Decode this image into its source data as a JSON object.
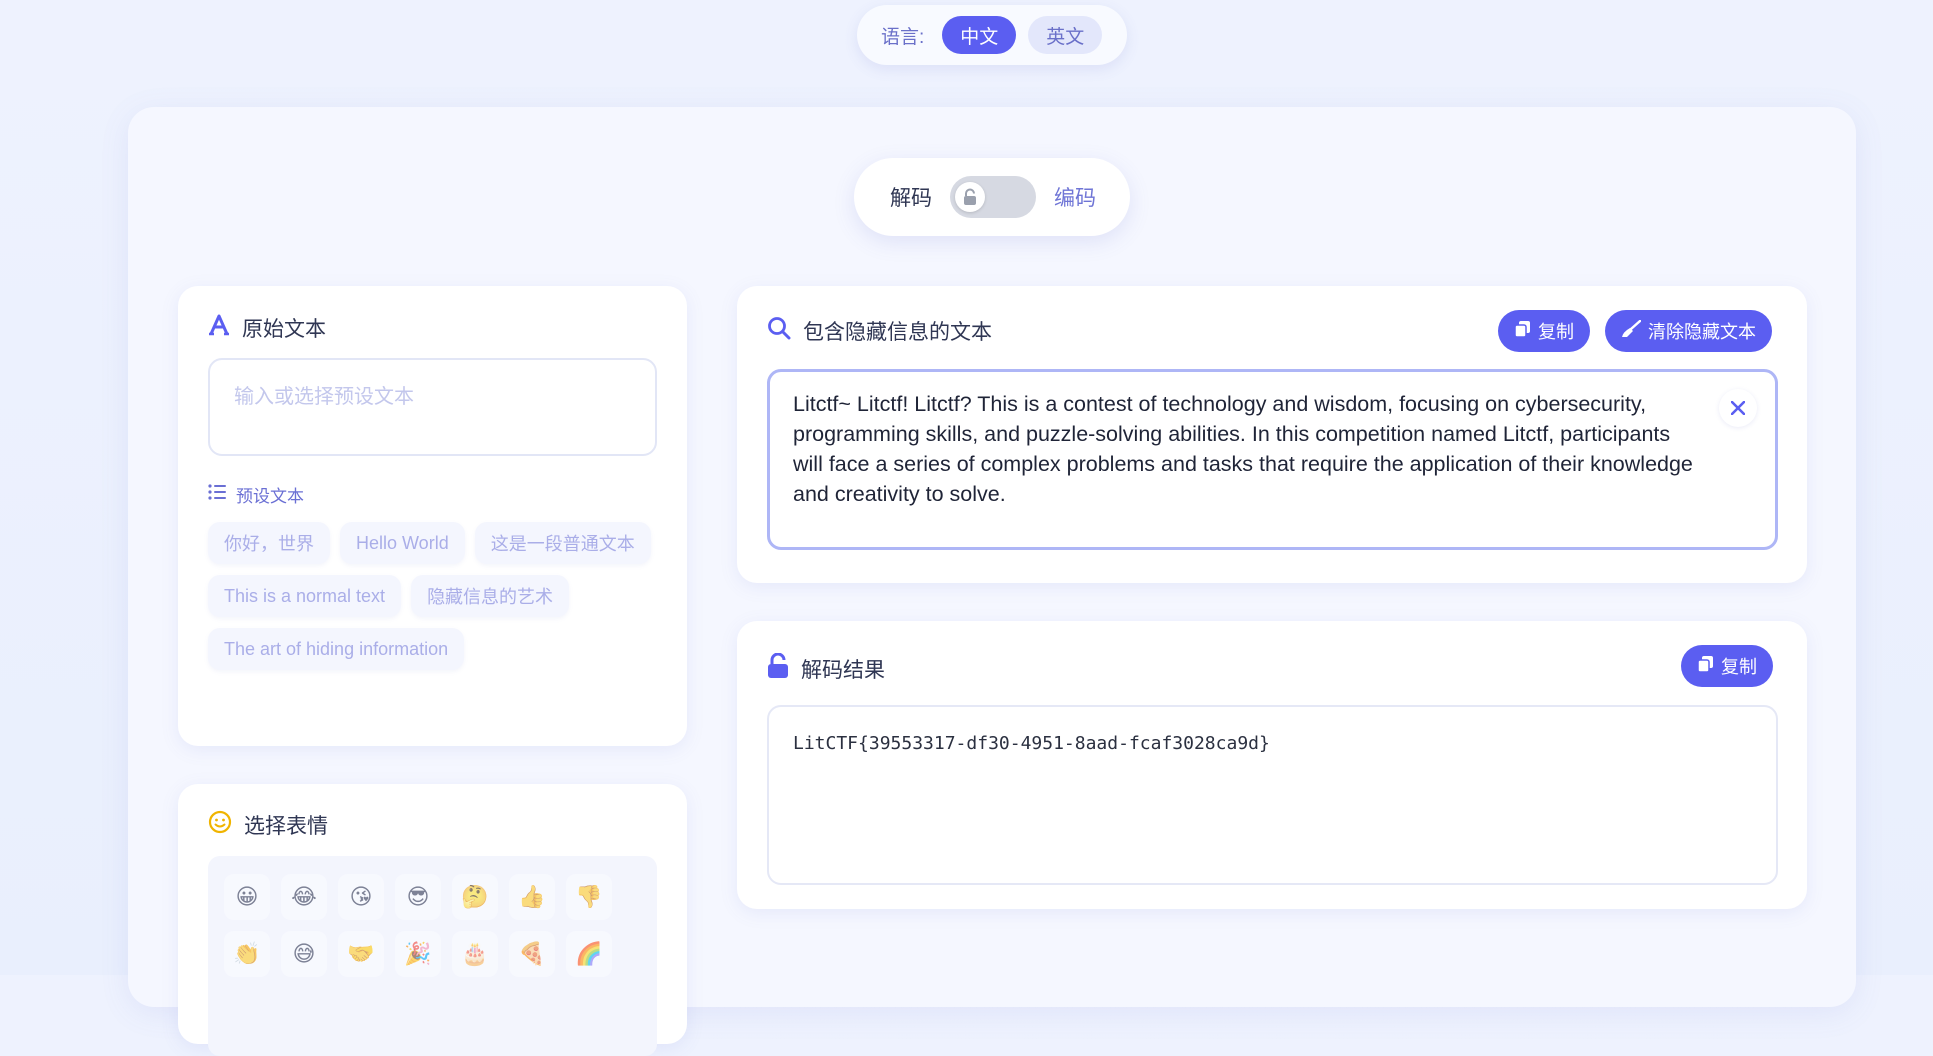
{
  "language": {
    "label": "语言:",
    "options": [
      "中文",
      "英文"
    ],
    "selected": "中文"
  },
  "mode": {
    "left_label": "解码",
    "right_label": "编码",
    "switch_icon": "lock-open-icon"
  },
  "original": {
    "title": "原始文本",
    "title_icon": "font-a-icon",
    "placeholder": "输入或选择预设文本",
    "preset_title": "预设文本",
    "preset_icon": "list-icon",
    "presets": [
      "你好，世界",
      "Hello World",
      "这是一段普通文本",
      "This is a normal text",
      "隐藏信息的艺术",
      "The art of hiding information"
    ]
  },
  "emoji": {
    "title": "选择表情",
    "title_icon": "smile-icon",
    "items": [
      "😀",
      "😂",
      "😘",
      "😎",
      "🤔",
      "👍",
      "👎",
      "👏",
      "😅",
      "🤝",
      "🎉",
      "🎂",
      "🍕",
      "🌈"
    ]
  },
  "hidden": {
    "title": "包含隐藏信息的文本",
    "title_icon": "search-icon",
    "copy_label": "复制",
    "clear_label": "清除隐藏文本",
    "text": "Litctf~ Litctf! Litctf? This is a contest of technology and wisdom, focusing on cybersecurity, programming skills, and puzzle-solving abilities. In this competition named Litctf, participants will face a series of complex problems and tasks that require the application of their knowledge and creativity to solve."
  },
  "result": {
    "title": "解码结果",
    "title_icon": "unlock-icon",
    "copy_label": "复制",
    "value": "LitCTF{39553317-df30-4951-8aad-fcaf3028ca9d}"
  },
  "colors": {
    "accent": "#5b5ef1",
    "background": "#eef2fe",
    "chip_text": "#aaaee8",
    "emoji_title_icon": "#f0b400"
  }
}
